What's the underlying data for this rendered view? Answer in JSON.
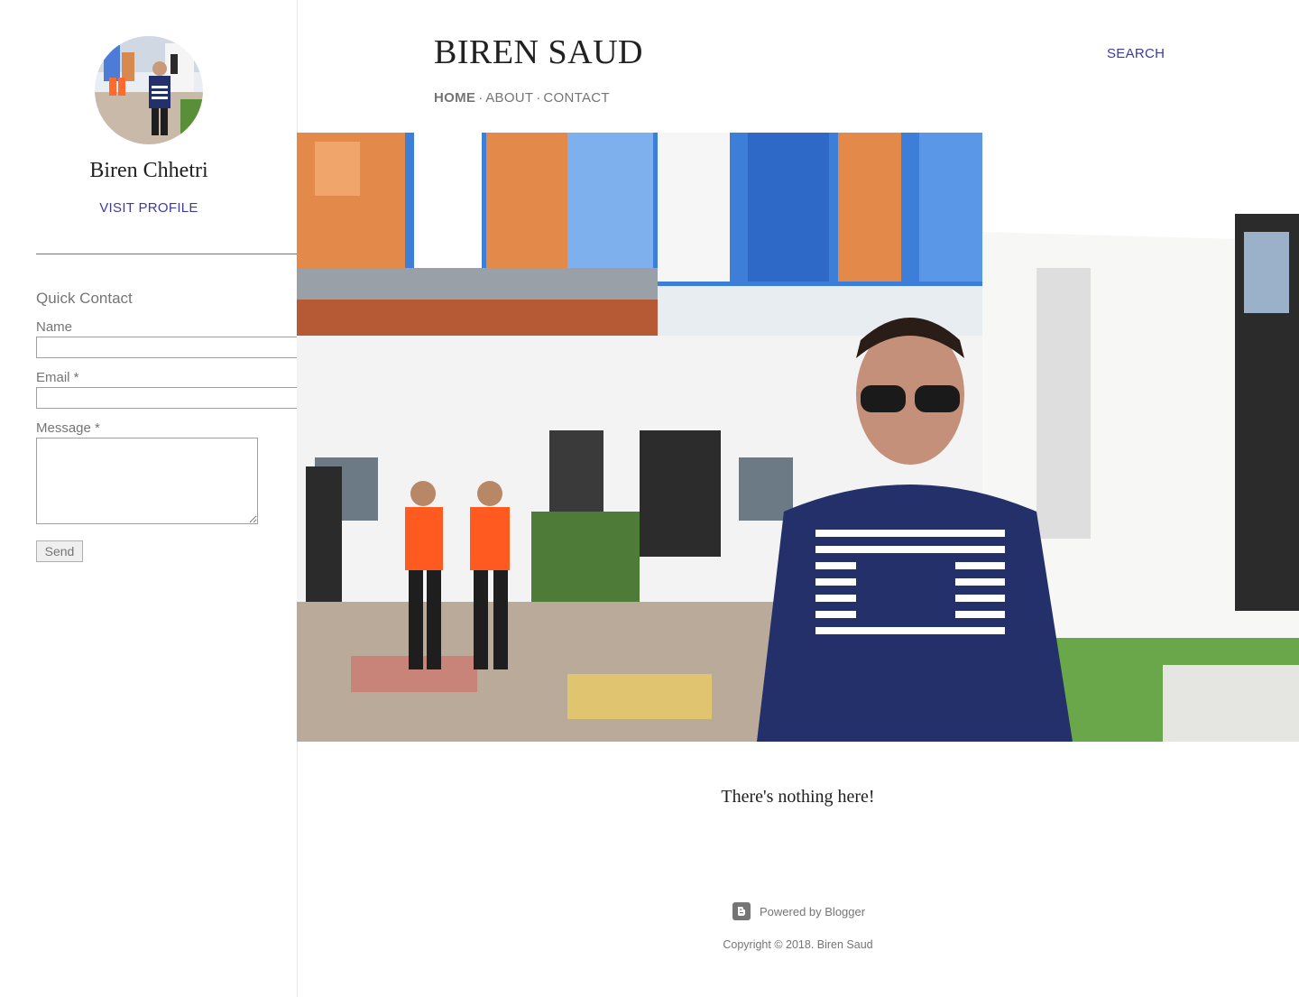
{
  "sidebar": {
    "profile_name": "Biren Chhetri",
    "visit_profile_label": "VISIT PROFILE",
    "contact": {
      "title": "Quick Contact",
      "name_label": "Name",
      "email_label": "Email *",
      "message_label": "Message *",
      "send_label": "Send"
    }
  },
  "header": {
    "site_title": "BIREN SAUD",
    "search_label": "SEARCH",
    "nav": [
      {
        "label": "HOME",
        "active": true
      },
      {
        "label": "ABOUT",
        "active": false
      },
      {
        "label": "CONTACT",
        "active": false
      }
    ],
    "nav_separator": "·"
  },
  "main": {
    "empty_message": "There's nothing here!"
  },
  "footer": {
    "powered_by": "Powered by Blogger",
    "copyright": "Copyright © 2018. Biren Saud"
  },
  "colors": {
    "accent": "#3f3b9a",
    "text": "#757575",
    "heading": "#212121"
  }
}
